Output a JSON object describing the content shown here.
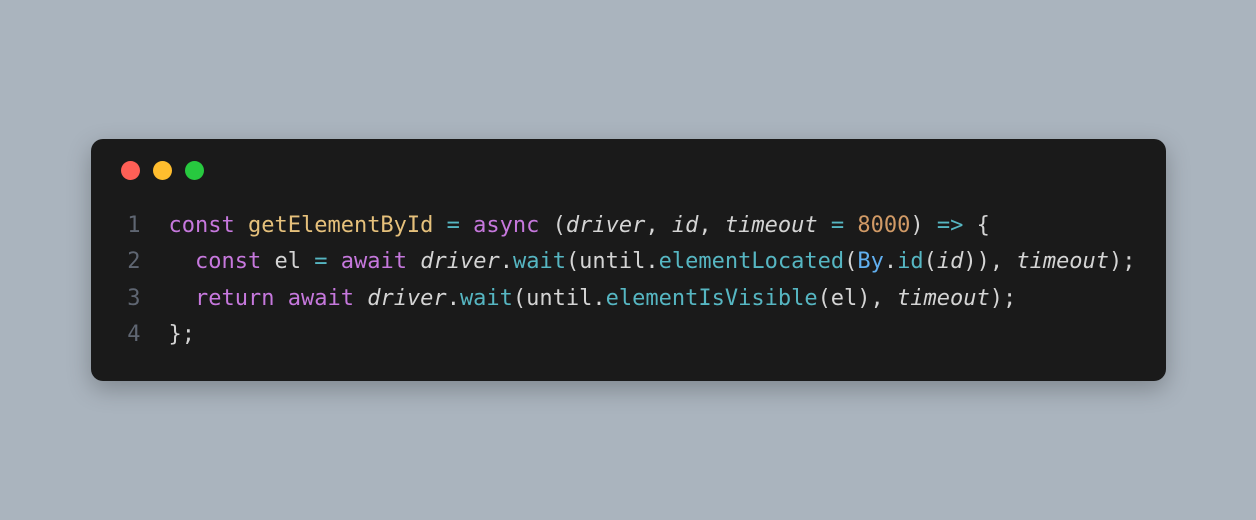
{
  "code": {
    "lines": [
      {
        "n": "1",
        "tokens": [
          {
            "t": "const ",
            "c": "tok-keyword"
          },
          {
            "t": "getElementById",
            "c": "tok-funcname"
          },
          {
            "t": " ",
            "c": "tok-punct"
          },
          {
            "t": "=",
            "c": "tok-operator"
          },
          {
            "t": " ",
            "c": "tok-punct"
          },
          {
            "t": "async",
            "c": "tok-keyword2"
          },
          {
            "t": " (",
            "c": "tok-punct"
          },
          {
            "t": "driver",
            "c": "tok-param"
          },
          {
            "t": ", ",
            "c": "tok-punct"
          },
          {
            "t": "id",
            "c": "tok-param"
          },
          {
            "t": ", ",
            "c": "tok-punct"
          },
          {
            "t": "timeout",
            "c": "tok-param"
          },
          {
            "t": " ",
            "c": "tok-punct"
          },
          {
            "t": "=",
            "c": "tok-operator"
          },
          {
            "t": " ",
            "c": "tok-punct"
          },
          {
            "t": "8000",
            "c": "tok-number"
          },
          {
            "t": ") ",
            "c": "tok-punct"
          },
          {
            "t": "=>",
            "c": "tok-operator"
          },
          {
            "t": " {",
            "c": "tok-punct"
          }
        ]
      },
      {
        "n": "2",
        "tokens": [
          {
            "t": "  ",
            "c": "tok-punct"
          },
          {
            "t": "const ",
            "c": "tok-keyword"
          },
          {
            "t": "el ",
            "c": "tok-punct"
          },
          {
            "t": "=",
            "c": "tok-operator"
          },
          {
            "t": " ",
            "c": "tok-punct"
          },
          {
            "t": "await",
            "c": "tok-keyword2"
          },
          {
            "t": " ",
            "c": "tok-punct"
          },
          {
            "t": "driver",
            "c": "tok-ident"
          },
          {
            "t": ".",
            "c": "tok-punct"
          },
          {
            "t": "wait",
            "c": "tok-method"
          },
          {
            "t": "(until.",
            "c": "tok-punct"
          },
          {
            "t": "elementLocated",
            "c": "tok-method"
          },
          {
            "t": "(",
            "c": "tok-punct"
          },
          {
            "t": "By",
            "c": "tok-class"
          },
          {
            "t": ".",
            "c": "tok-punct"
          },
          {
            "t": "id",
            "c": "tok-method"
          },
          {
            "t": "(",
            "c": "tok-punct"
          },
          {
            "t": "id",
            "c": "tok-ident"
          },
          {
            "t": ")), ",
            "c": "tok-punct"
          },
          {
            "t": "timeout",
            "c": "tok-ident"
          },
          {
            "t": ");",
            "c": "tok-punct"
          }
        ]
      },
      {
        "n": "3",
        "tokens": [
          {
            "t": "  ",
            "c": "tok-punct"
          },
          {
            "t": "return ",
            "c": "tok-keyword2"
          },
          {
            "t": "await",
            "c": "tok-keyword2"
          },
          {
            "t": " ",
            "c": "tok-punct"
          },
          {
            "t": "driver",
            "c": "tok-ident"
          },
          {
            "t": ".",
            "c": "tok-punct"
          },
          {
            "t": "wait",
            "c": "tok-method"
          },
          {
            "t": "(until.",
            "c": "tok-punct"
          },
          {
            "t": "elementIsVisible",
            "c": "tok-method"
          },
          {
            "t": "(el), ",
            "c": "tok-punct"
          },
          {
            "t": "timeout",
            "c": "tok-ident"
          },
          {
            "t": ");",
            "c": "tok-punct"
          }
        ]
      },
      {
        "n": "4",
        "tokens": [
          {
            "t": "};",
            "c": "tok-punct"
          }
        ]
      }
    ]
  }
}
